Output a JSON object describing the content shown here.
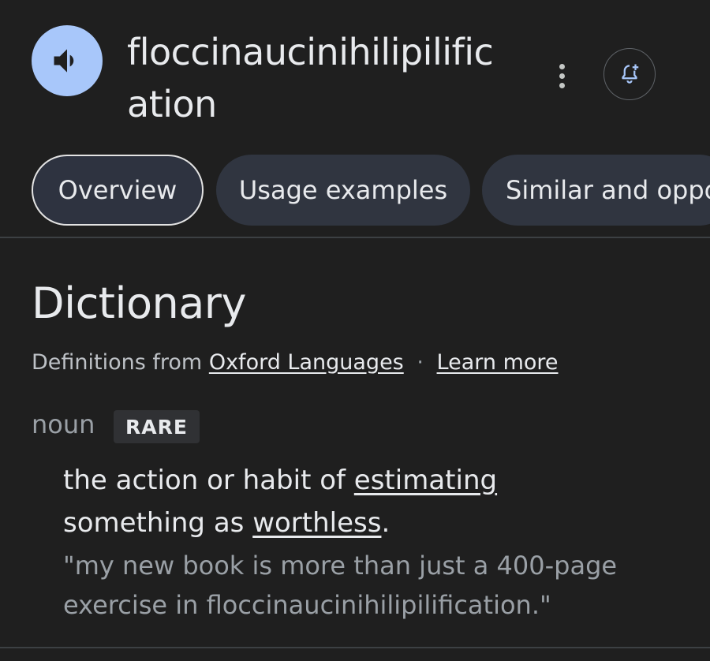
{
  "header": {
    "word": "floccinaucinihilipilification",
    "speaker_icon": "volume-up-icon",
    "more_icon": "more-vert-icon",
    "alert_icon": "add-alert-icon",
    "accent_color": "#a8c7fa"
  },
  "tabs": [
    {
      "label": "Overview",
      "selected": true
    },
    {
      "label": "Usage examples",
      "selected": false
    },
    {
      "label": "Similar and opposite words",
      "selected": false
    }
  ],
  "dictionary": {
    "heading": "Dictionary",
    "source_prefix": "Definitions from",
    "source_link": "Oxford Languages",
    "separator": "·",
    "learn_more": "Learn more",
    "part_of_speech": "noun",
    "badge": "RARE",
    "definition": {
      "part1": "the action or habit of ",
      "link1": "estimating",
      "part2": " something as ",
      "link2": "worthless",
      "part3": "."
    },
    "example": "\"my new book is more than just a 400-page exercise in floccinaucinihilipilification.\""
  }
}
